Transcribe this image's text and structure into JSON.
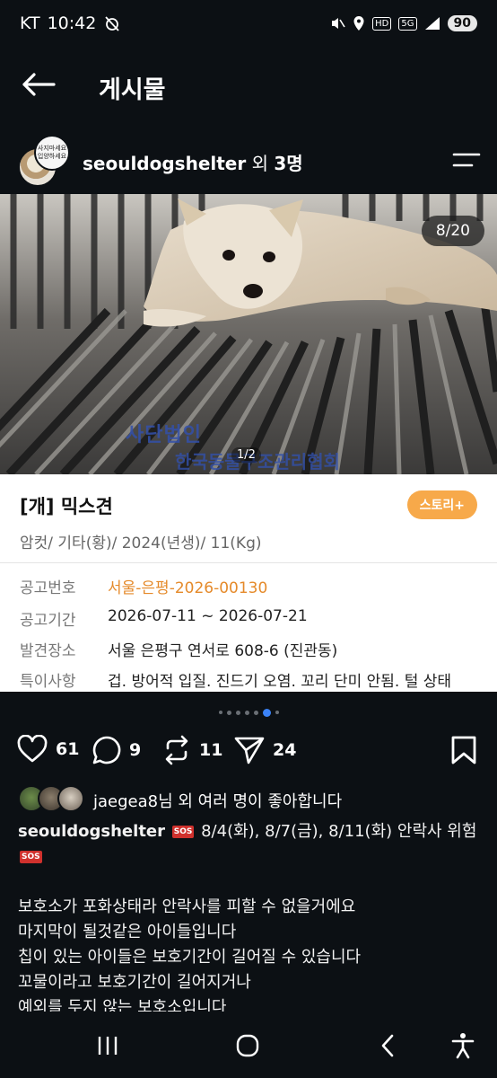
{
  "status_bar": {
    "carrier": "KT",
    "time": "10:42",
    "hd": "HD",
    "net": "5G",
    "battery": "90"
  },
  "header": {
    "title": "게시물"
  },
  "author": {
    "username": "seouldogshelter",
    "suffix": " 외 ",
    "count": "3명",
    "sub_avatar_text": "사지마세요 입양하세요"
  },
  "photo": {
    "counter": "8/20",
    "watermark_1": "사단법인",
    "watermark_2": "한국동물구조관리협회",
    "inner_page": "1/2"
  },
  "card": {
    "title": "[개] 믹스견",
    "story_button": "스토리+",
    "subtitle": "암컷/ 기타(황)/ 2024(년생)/ 11(Kg)",
    "rows": [
      {
        "key": "공고번호",
        "value": "서울-은평-2026-00130"
      },
      {
        "key": "공고기간",
        "value": "2026-07-11 ~ 2026-07-21"
      },
      {
        "key": "발견장소",
        "value": "서울 은평구 연서로 608-6 (진관동)"
      },
      {
        "key": "특이사항",
        "value": "겁. 방어적 입질. 진드기 오염. 꼬리 단미 안됨. 털 상태"
      }
    ]
  },
  "actions": {
    "likes": "61",
    "comments": "9",
    "reposts": "11",
    "shares": "24"
  },
  "liked_by": {
    "text": "jaegea8님 외 여러 명이 좋아합니다"
  },
  "caption": {
    "username": "seouldogshelter",
    "sos": "SOS",
    "headline": " 8/4(화), 8/7(금), 8/11(화) 안락사 위험 ",
    "lines": [
      "보호소가 포화상태라 안락사를 피할 수 없을거에요",
      "마지막이 될것같은 아이들입니다",
      "칩이 있는 아이들은 보호기간이 길어질 수 있습니다",
      "꼬물이라고 보호기간이 길어지거나",
      "예외를 두지 않는 보호소입니다"
    ]
  },
  "icons": {
    "back": "arrow-left-icon",
    "menu": "menu-icon",
    "like": "heart-icon",
    "comment": "comment-icon",
    "repost": "repost-icon",
    "share": "send-icon",
    "bookmark": "bookmark-icon"
  },
  "colors": {
    "background": "#0c1014",
    "accent_orange": "#e58a2a",
    "story_button": "#f7a94a",
    "active_dot": "#3b82f6",
    "sos_red": "#d0312d"
  }
}
